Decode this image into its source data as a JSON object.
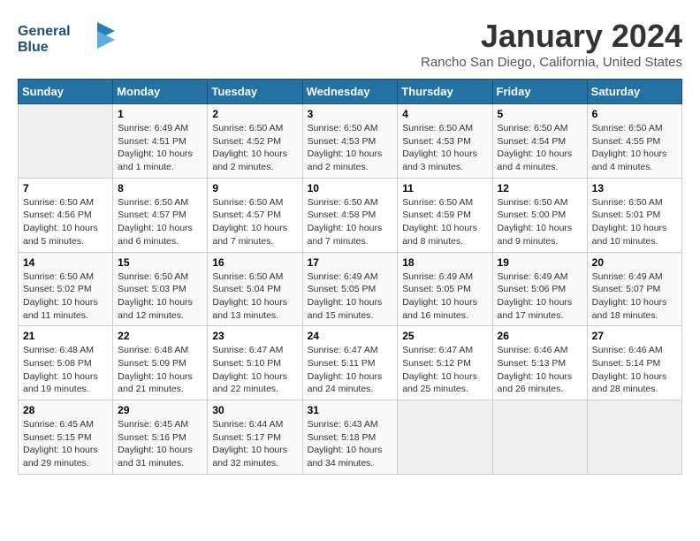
{
  "header": {
    "logo_line1": "General",
    "logo_line2": "Blue",
    "month_title": "January 2024",
    "location": "Rancho San Diego, California, United States"
  },
  "weekdays": [
    "Sunday",
    "Monday",
    "Tuesday",
    "Wednesday",
    "Thursday",
    "Friday",
    "Saturday"
  ],
  "weeks": [
    [
      {
        "num": "",
        "info": ""
      },
      {
        "num": "1",
        "info": "Sunrise: 6:49 AM\nSunset: 4:51 PM\nDaylight: 10 hours\nand 1 minute."
      },
      {
        "num": "2",
        "info": "Sunrise: 6:50 AM\nSunset: 4:52 PM\nDaylight: 10 hours\nand 2 minutes."
      },
      {
        "num": "3",
        "info": "Sunrise: 6:50 AM\nSunset: 4:53 PM\nDaylight: 10 hours\nand 2 minutes."
      },
      {
        "num": "4",
        "info": "Sunrise: 6:50 AM\nSunset: 4:53 PM\nDaylight: 10 hours\nand 3 minutes."
      },
      {
        "num": "5",
        "info": "Sunrise: 6:50 AM\nSunset: 4:54 PM\nDaylight: 10 hours\nand 4 minutes."
      },
      {
        "num": "6",
        "info": "Sunrise: 6:50 AM\nSunset: 4:55 PM\nDaylight: 10 hours\nand 4 minutes."
      }
    ],
    [
      {
        "num": "7",
        "info": "Sunrise: 6:50 AM\nSunset: 4:56 PM\nDaylight: 10 hours\nand 5 minutes."
      },
      {
        "num": "8",
        "info": "Sunrise: 6:50 AM\nSunset: 4:57 PM\nDaylight: 10 hours\nand 6 minutes."
      },
      {
        "num": "9",
        "info": "Sunrise: 6:50 AM\nSunset: 4:57 PM\nDaylight: 10 hours\nand 7 minutes."
      },
      {
        "num": "10",
        "info": "Sunrise: 6:50 AM\nSunset: 4:58 PM\nDaylight: 10 hours\nand 7 minutes."
      },
      {
        "num": "11",
        "info": "Sunrise: 6:50 AM\nSunset: 4:59 PM\nDaylight: 10 hours\nand 8 minutes."
      },
      {
        "num": "12",
        "info": "Sunrise: 6:50 AM\nSunset: 5:00 PM\nDaylight: 10 hours\nand 9 minutes."
      },
      {
        "num": "13",
        "info": "Sunrise: 6:50 AM\nSunset: 5:01 PM\nDaylight: 10 hours\nand 10 minutes."
      }
    ],
    [
      {
        "num": "14",
        "info": "Sunrise: 6:50 AM\nSunset: 5:02 PM\nDaylight: 10 hours\nand 11 minutes."
      },
      {
        "num": "15",
        "info": "Sunrise: 6:50 AM\nSunset: 5:03 PM\nDaylight: 10 hours\nand 12 minutes."
      },
      {
        "num": "16",
        "info": "Sunrise: 6:50 AM\nSunset: 5:04 PM\nDaylight: 10 hours\nand 13 minutes."
      },
      {
        "num": "17",
        "info": "Sunrise: 6:49 AM\nSunset: 5:05 PM\nDaylight: 10 hours\nand 15 minutes."
      },
      {
        "num": "18",
        "info": "Sunrise: 6:49 AM\nSunset: 5:05 PM\nDaylight: 10 hours\nand 16 minutes."
      },
      {
        "num": "19",
        "info": "Sunrise: 6:49 AM\nSunset: 5:06 PM\nDaylight: 10 hours\nand 17 minutes."
      },
      {
        "num": "20",
        "info": "Sunrise: 6:49 AM\nSunset: 5:07 PM\nDaylight: 10 hours\nand 18 minutes."
      }
    ],
    [
      {
        "num": "21",
        "info": "Sunrise: 6:48 AM\nSunset: 5:08 PM\nDaylight: 10 hours\nand 19 minutes."
      },
      {
        "num": "22",
        "info": "Sunrise: 6:48 AM\nSunset: 5:09 PM\nDaylight: 10 hours\nand 21 minutes."
      },
      {
        "num": "23",
        "info": "Sunrise: 6:47 AM\nSunset: 5:10 PM\nDaylight: 10 hours\nand 22 minutes."
      },
      {
        "num": "24",
        "info": "Sunrise: 6:47 AM\nSunset: 5:11 PM\nDaylight: 10 hours\nand 24 minutes."
      },
      {
        "num": "25",
        "info": "Sunrise: 6:47 AM\nSunset: 5:12 PM\nDaylight: 10 hours\nand 25 minutes."
      },
      {
        "num": "26",
        "info": "Sunrise: 6:46 AM\nSunset: 5:13 PM\nDaylight: 10 hours\nand 26 minutes."
      },
      {
        "num": "27",
        "info": "Sunrise: 6:46 AM\nSunset: 5:14 PM\nDaylight: 10 hours\nand 28 minutes."
      }
    ],
    [
      {
        "num": "28",
        "info": "Sunrise: 6:45 AM\nSunset: 5:15 PM\nDaylight: 10 hours\nand 29 minutes."
      },
      {
        "num": "29",
        "info": "Sunrise: 6:45 AM\nSunset: 5:16 PM\nDaylight: 10 hours\nand 31 minutes."
      },
      {
        "num": "30",
        "info": "Sunrise: 6:44 AM\nSunset: 5:17 PM\nDaylight: 10 hours\nand 32 minutes."
      },
      {
        "num": "31",
        "info": "Sunrise: 6:43 AM\nSunset: 5:18 PM\nDaylight: 10 hours\nand 34 minutes."
      },
      {
        "num": "",
        "info": ""
      },
      {
        "num": "",
        "info": ""
      },
      {
        "num": "",
        "info": ""
      }
    ]
  ]
}
